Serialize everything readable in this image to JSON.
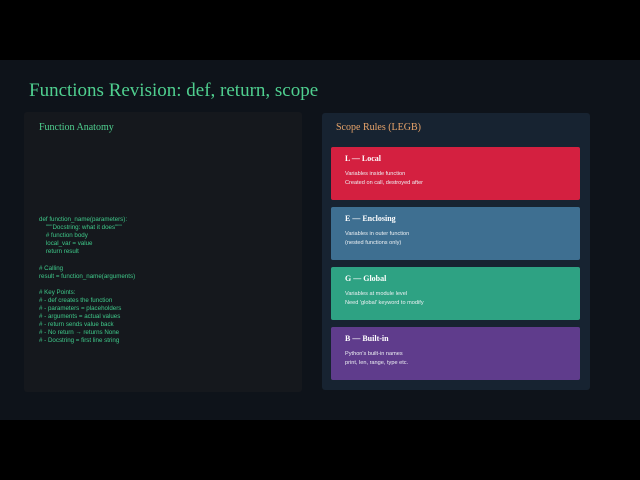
{
  "slide": {
    "title": "Functions Revision: def, return, scope"
  },
  "anatomy": {
    "title": "Function Anatomy",
    "code": "def function_name(parameters):\n    \"\"\"Docstring: what it does\"\"\"\n    # function body\n    local_var = value\n    return result\n\n# Calling\nresult = function_name(arguments)\n\n# Key Points:\n# - def creates the function\n# - parameters = placeholders\n# - arguments = actual values\n# - return sends value back\n# - No return → returns None\n# - Docstring = first line string"
  },
  "scope": {
    "title": "Scope Rules (LEGB)",
    "cards": [
      {
        "title": "L — Local",
        "line1": "Variables inside function",
        "line2": "Created on call, destroyed after",
        "color": "#d42040"
      },
      {
        "title": "E — Enclosing",
        "line1": "Variables in outer function",
        "line2": "(nested functions only)",
        "color": "#3e6f91"
      },
      {
        "title": "G — Global",
        "line1": "Variables at module level",
        "line2": "Need 'global' keyword to modify",
        "color": "#2ea283"
      },
      {
        "title": "B — Built-in",
        "line1": "Python's built-in names",
        "line2": "print, len, range, type etc.",
        "color": "#5f3c8c"
      }
    ]
  },
  "colors": {
    "background": "#0e131a",
    "accent_green": "#4fcf8f",
    "accent_orange": "#e8a46a"
  }
}
